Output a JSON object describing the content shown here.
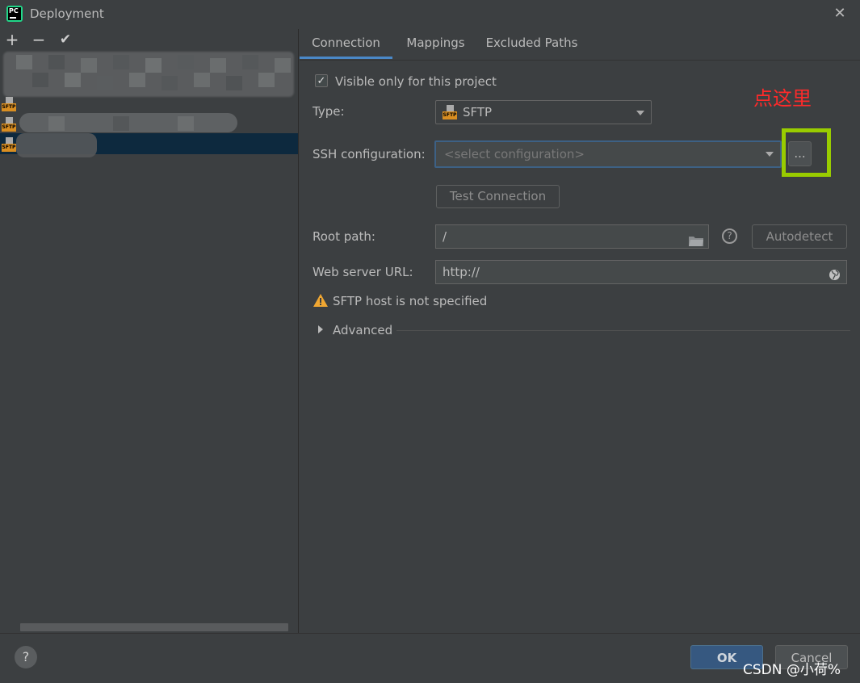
{
  "window": {
    "title": "Deployment",
    "close_glyph": "✕",
    "app_icon_text": "PC"
  },
  "toolbar": {
    "add": "+",
    "remove": "−",
    "confirm": "✔"
  },
  "tabs": [
    {
      "label": "Connection",
      "active": true
    },
    {
      "label": "Mappings",
      "active": false
    },
    {
      "label": "Excluded Paths",
      "active": false
    }
  ],
  "form": {
    "visible_only_label": "Visible only for this project",
    "visible_only_checked": true,
    "type_label": "Type:",
    "type_value": "SFTP",
    "type_icon_text": "SFTP",
    "ssh_label": "SSH configuration:",
    "ssh_placeholder": "<select configuration>",
    "ellipsis_label": "...",
    "test_connection_label": "Test Connection",
    "root_path_label": "Root path:",
    "root_path_value": "/",
    "autodetect_label": "Autodetect",
    "web_url_label": "Web server URL:",
    "web_url_value": "http://",
    "warning_text": "SFTP host is not specified",
    "advanced_label": "Advanced"
  },
  "footer": {
    "help": "?",
    "ok": "OK",
    "cancel": "Cancel"
  },
  "annotation": "点这里",
  "watermark": "CSDN @小荷%",
  "colors": {
    "background": "#3c3f41",
    "accent": "#4a88c7",
    "highlight": "#99cc00",
    "annotation": "#ff2a2a",
    "selected_row": "#0d293e",
    "warning": "#f0a732"
  }
}
